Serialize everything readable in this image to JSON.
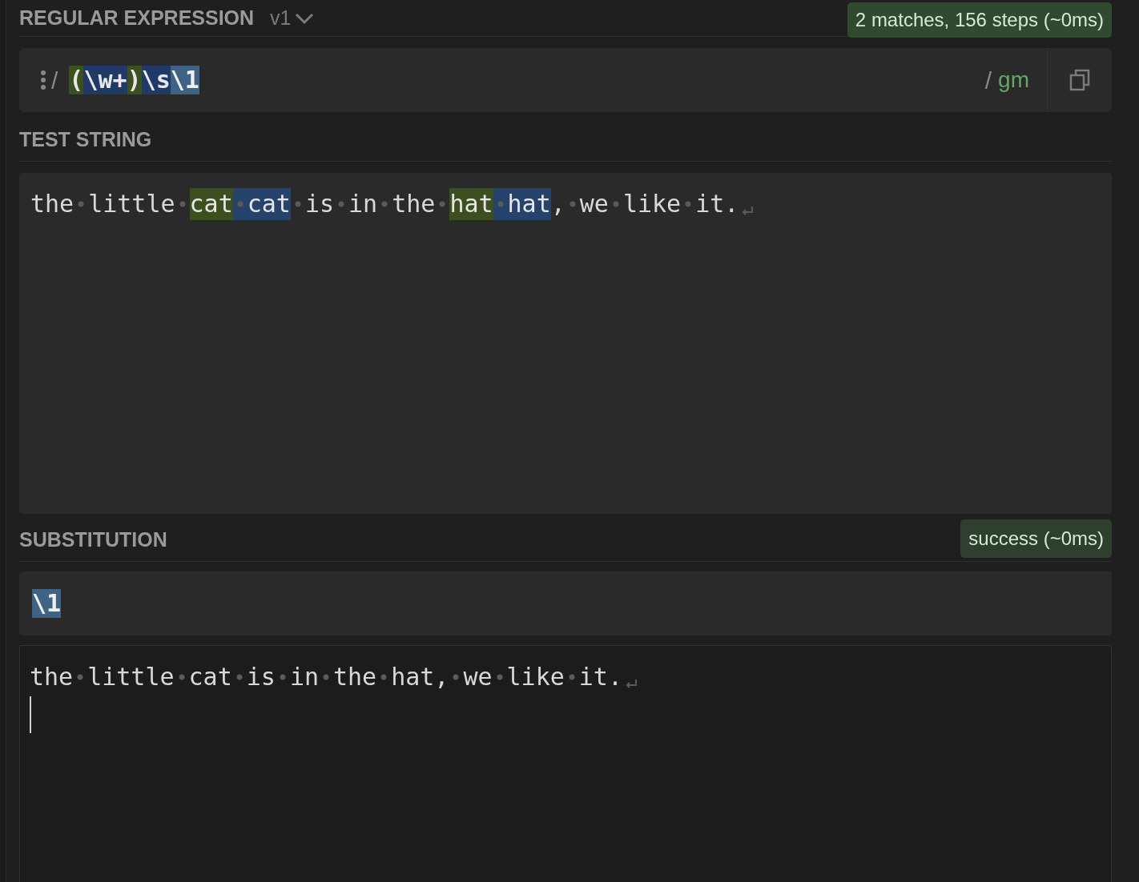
{
  "regex": {
    "title": "REGULAR EXPRESSION",
    "version": "v1",
    "status": "2 matches, 156 steps (~0ms)",
    "delimiter": "/",
    "tokens": [
      {
        "text": "(",
        "kind": "group"
      },
      {
        "text": "\\w+",
        "kind": "token"
      },
      {
        "text": ")",
        "kind": "group"
      },
      {
        "text": "\\s",
        "kind": "token"
      },
      {
        "text": "\\1",
        "kind": "backref"
      }
    ],
    "flags_delimiter": "/",
    "flags": "gm"
  },
  "test_string": {
    "title": "TEST STRING",
    "segments": [
      {
        "text": "the little ",
        "kind": "plain"
      },
      {
        "text": "cat",
        "kind": "group"
      },
      {
        "text": " cat",
        "kind": "match"
      },
      {
        "text": " is in the ",
        "kind": "plain"
      },
      {
        "text": "hat",
        "kind": "group"
      },
      {
        "text": " hat",
        "kind": "match"
      },
      {
        "text": ", we like it.",
        "kind": "plain"
      }
    ]
  },
  "substitution": {
    "title": "SUBSTITUTION",
    "status": "success (~0ms)",
    "tokens": [
      {
        "text": "\\1",
        "kind": "backref"
      }
    ],
    "result": "the little cat is in the hat, we like it."
  }
}
